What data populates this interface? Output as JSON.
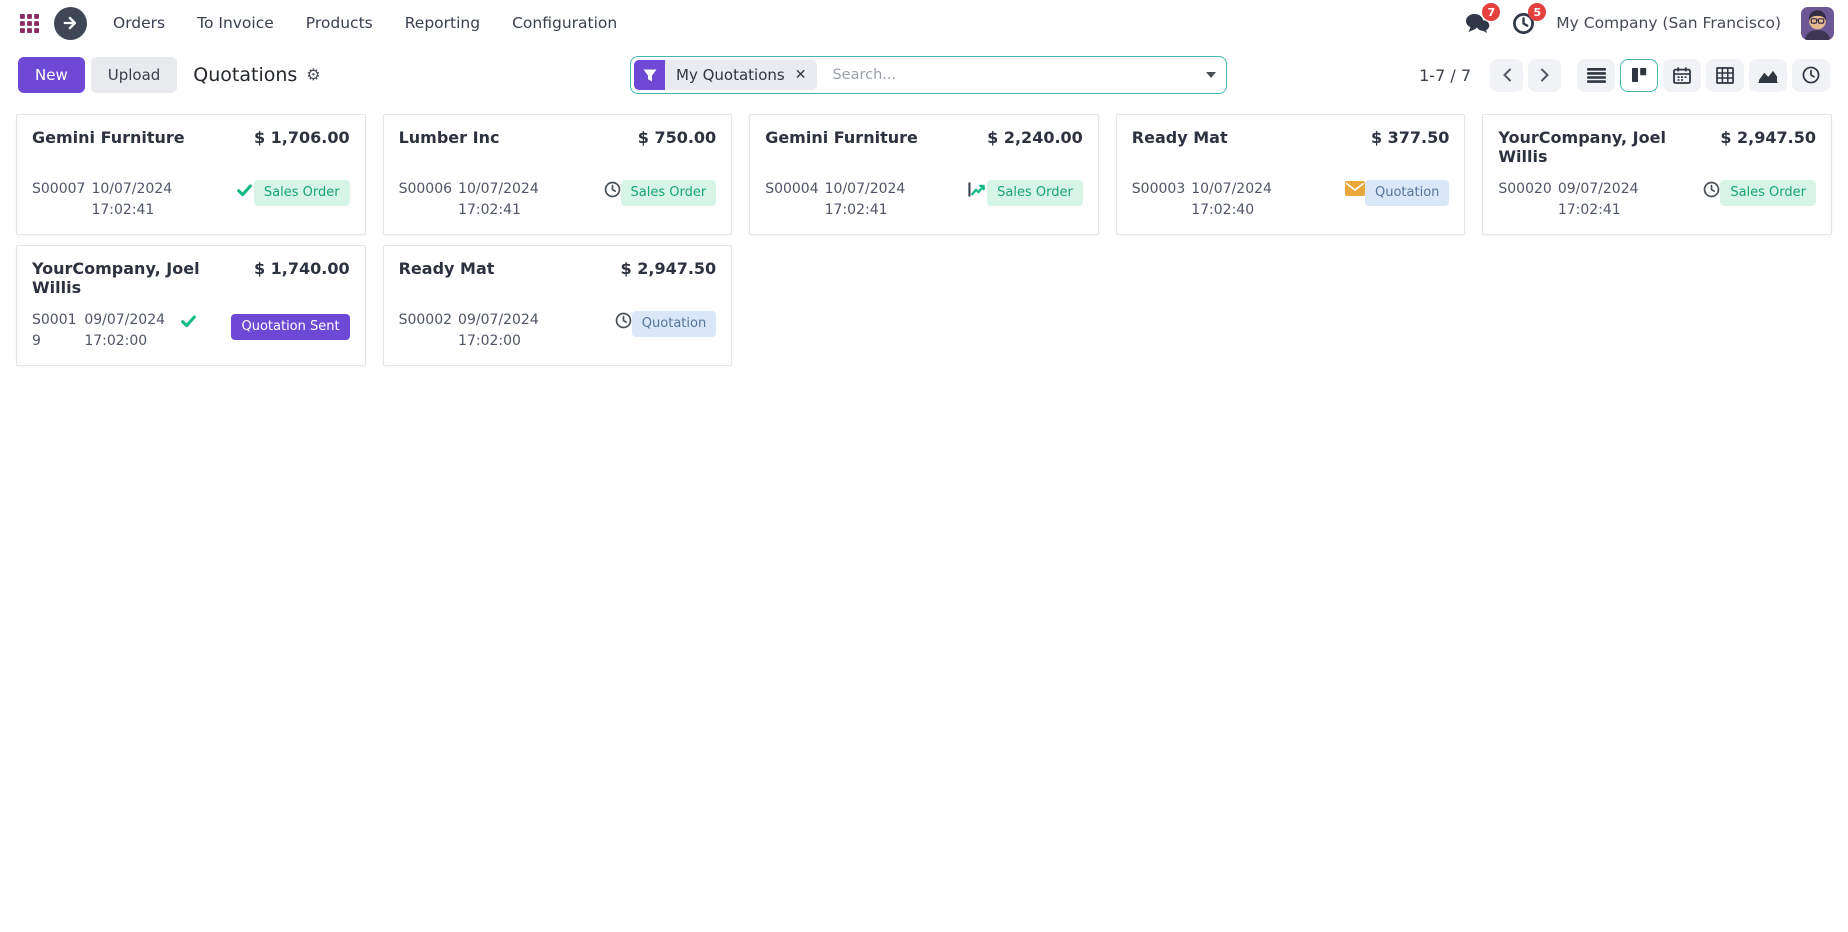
{
  "nav": {
    "menu_items": [
      "Orders",
      "To Invoice",
      "Products",
      "Reporting",
      "Configuration"
    ],
    "messages_badge": "7",
    "activities_badge": "5",
    "company": "My Company (San Francisco)"
  },
  "control_panel": {
    "new_label": "New",
    "upload_label": "Upload",
    "title": "Quotations",
    "search": {
      "facet_label": "My Quotations",
      "placeholder": "Search..."
    },
    "pagination": "1-7 / 7",
    "views": [
      "list",
      "kanban",
      "calendar",
      "pivot",
      "graph",
      "activity"
    ],
    "active_view": "kanban"
  },
  "cards": [
    {
      "customer": "Gemini Furniture",
      "amount": "$ 1,706.00",
      "reference": "S00007",
      "datetime": "10/07/2024 17:02:41",
      "activity_icon": "check",
      "status": "Sales Order",
      "status_type": "success",
      "wrapped": false
    },
    {
      "customer": "Lumber Inc",
      "amount": "$ 750.00",
      "reference": "S00006",
      "datetime": "10/07/2024 17:02:41",
      "activity_icon": "clock",
      "status": "Sales Order",
      "status_type": "success",
      "wrapped": false
    },
    {
      "customer": "Gemini Furniture",
      "amount": "$ 2,240.00",
      "reference": "S00004",
      "datetime": "10/07/2024 17:02:41",
      "activity_icon": "trend",
      "status": "Sales Order",
      "status_type": "success",
      "wrapped": false
    },
    {
      "customer": "Ready Mat",
      "amount": "$ 377.50",
      "reference": "S00003",
      "datetime": "10/07/2024 17:02:40",
      "activity_icon": "envelope",
      "status": "Quotation",
      "status_type": "info",
      "wrapped": false
    },
    {
      "customer": "YourCompany, Joel Willis",
      "amount": "$ 2,947.50",
      "reference": "S00020",
      "datetime": "09/07/2024 17:02:41",
      "activity_icon": "clock",
      "status": "Sales Order",
      "status_type": "success",
      "wrapped": false
    },
    {
      "customer": "YourCompany, Joel Willis",
      "amount": "$ 1,740.00",
      "reference": "S00019",
      "datetime": "09/07/2024 17:02:00",
      "activity_icon": "check",
      "status": "Quotation Sent",
      "status_type": "primary",
      "wrapped": true
    },
    {
      "customer": "Ready Mat",
      "amount": "$ 2,947.50",
      "reference": "S00002",
      "datetime": "09/07/2024 17:02:00",
      "activity_icon": "clock",
      "status": "Quotation",
      "status_type": "info",
      "wrapped": false
    }
  ],
  "colors": {
    "primary": "#6e49d6",
    "teal": "#45b8b2",
    "success_bg": "#d7f5e6",
    "success_text": "#16a573",
    "info_bg": "#d9e7f8",
    "info_text": "#56749c",
    "check_green": "#12b886",
    "envelope_orange": "#e9a83b",
    "badge_red": "#e5413e",
    "apps_purple": "#8a2c62"
  }
}
